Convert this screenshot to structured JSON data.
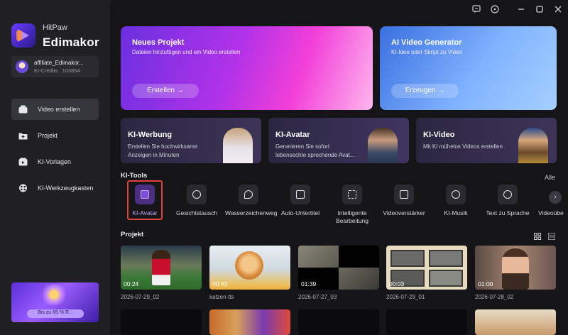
{
  "app": {
    "brand_small": "HitPaw",
    "brand_big": "Edimakor"
  },
  "account": {
    "name": "affiliate_Edimakor...",
    "credits": "KI-Credits : 103654"
  },
  "sidebar": {
    "items": [
      {
        "label": "Video erstellen",
        "icon": "home-icon",
        "active": true
      },
      {
        "label": "Projekt",
        "icon": "folder-icon",
        "active": false
      },
      {
        "label": "KI-Vorlagen",
        "icon": "template-icon",
        "active": false
      },
      {
        "label": "KI-Werkzeugkasten",
        "icon": "toolbox-icon",
        "active": false
      }
    ],
    "promo_text": "Bis zu 65 % R..."
  },
  "hero": {
    "new_project": {
      "title": "Neues Projekt",
      "subtitle": "Dateien hinzufügen und ein Video erstellen",
      "button": "Erstellen →"
    },
    "ai_generator": {
      "title": "AI Video Generator",
      "subtitle": "KI-Idee oder Skript zu Video",
      "button": "Erzeugen →"
    }
  },
  "features": [
    {
      "title": "KI-Werbung",
      "desc": "Erstellen Sie hochwirksame Anzeigen in Minuten"
    },
    {
      "title": "KI-Avatar",
      "desc": "Generieren Sie sofort lebensechte sprechende Avat..."
    },
    {
      "title": "KI-Video",
      "desc": "Mit KI mühelos Videos erstellen"
    }
  ],
  "tools": {
    "section_title": "KI-Tools",
    "all_label": "Alle",
    "items": [
      {
        "label": "KI-Avatar",
        "icon": "avatar-icon",
        "active": true
      },
      {
        "label": "Gesichtstausch",
        "icon": "face-swap-icon"
      },
      {
        "label": "Wasserzeichenweg",
        "icon": "watermark-remove-icon"
      },
      {
        "label": "Auto-Untertitel",
        "icon": "subtitle-icon"
      },
      {
        "label": "Intelligente Bearbeitung",
        "icon": "smart-edit-icon"
      },
      {
        "label": "Videoverstärker",
        "icon": "enhance-icon"
      },
      {
        "label": "KI-Musik",
        "icon": "music-icon"
      },
      {
        "label": "Text zu Sprache",
        "icon": "tts-icon"
      },
      {
        "label": "Videoübe",
        "icon": "video-icon"
      }
    ]
  },
  "projects": {
    "section_title": "Projekt",
    "items": [
      {
        "name": "2026-07-29_02",
        "duration": "00:24"
      },
      {
        "name": "katzen-tts",
        "duration": "00:43"
      },
      {
        "name": "2026-07-27_03",
        "duration": "01:39"
      },
      {
        "name": "2026-07-29_01",
        "duration": "00:03"
      },
      {
        "name": "2026-07-28_02",
        "duration": "01:00"
      }
    ]
  },
  "colors": {
    "accent": "#8b5cf6",
    "selection_border": "#e0413a",
    "background": "#151518"
  }
}
